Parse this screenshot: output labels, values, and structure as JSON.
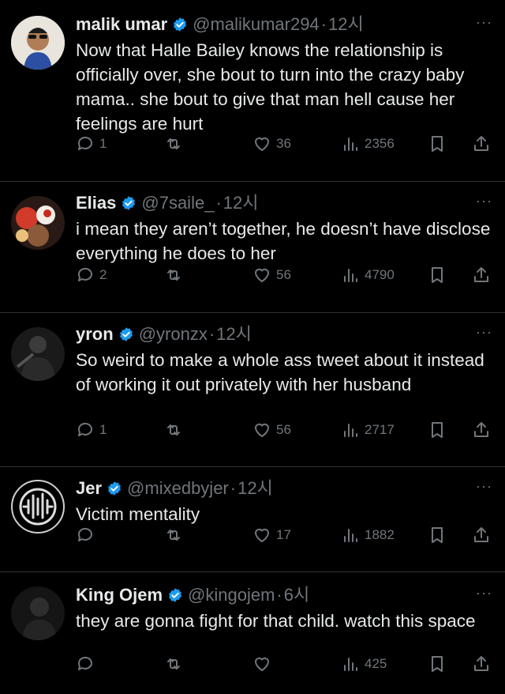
{
  "tweets": [
    {
      "name": "malik umar",
      "handle": "@malikumar294",
      "dot": "·",
      "time": "12시",
      "more": "···",
      "text": "Now that Halle Bailey knows the relationship is officially over, she bout to turn into the crazy baby mama.. she bout to give that man hell cause her feelings are hurt",
      "replies": "1",
      "retweets": "",
      "likes": "36",
      "views": "2356"
    },
    {
      "name": "Elias",
      "handle": "@7saile_",
      "dot": "·",
      "time": "12시",
      "more": "···",
      "text": "i mean they aren’t together, he doesn’t have disclose everything he does to her",
      "replies": "2",
      "retweets": "",
      "likes": "56",
      "views": "4790"
    },
    {
      "name": "yron",
      "handle": "@yronzx",
      "dot": "·",
      "time": "12시",
      "more": "···",
      "text": "So weird to make a whole ass tweet about it instead of working it out privately with her husband",
      "replies": "1",
      "retweets": "",
      "likes": "56",
      "views": "2717"
    },
    {
      "name": "Jer",
      "handle": "@mixedbyjer",
      "dot": "·",
      "time": "12시",
      "more": "···",
      "text": "Victim mentality",
      "replies": "",
      "retweets": "",
      "likes": "17",
      "views": "1882"
    },
    {
      "name": "King Ojem",
      "handle": "@kingojem",
      "dot": "·",
      "time": "6시",
      "more": "···",
      "text": "they are gonna fight for that child. watch this space",
      "replies": "",
      "retweets": "",
      "likes": "",
      "views": "425"
    }
  ],
  "colors": {
    "background": "#000000",
    "text": "#e7e9ea",
    "muted": "#71767b",
    "verified": "#1d9bf0",
    "divider": "#2f3336"
  }
}
